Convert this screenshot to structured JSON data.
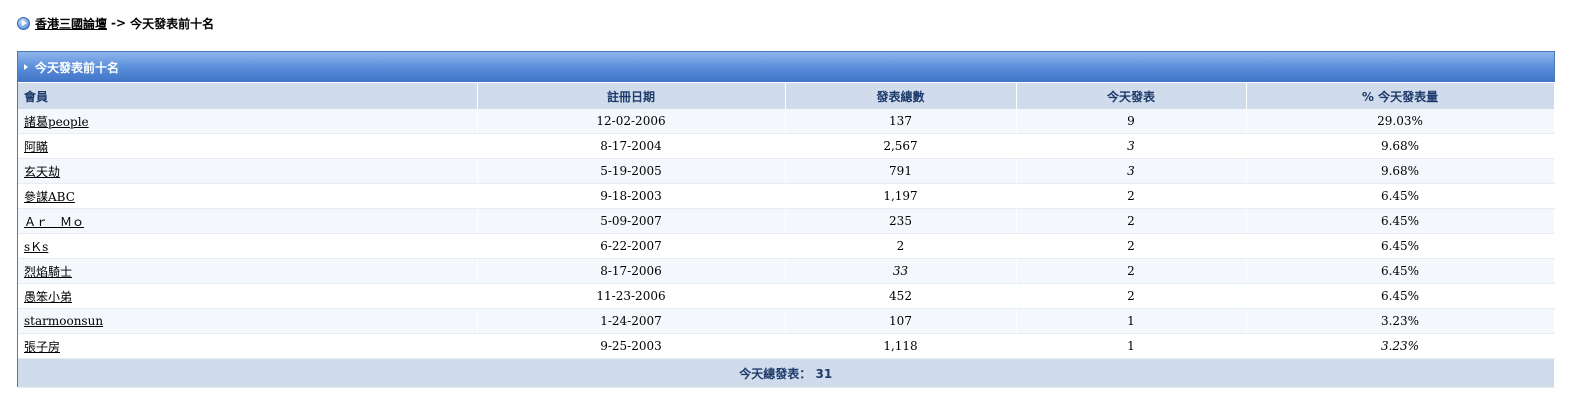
{
  "breadcrumb": {
    "forum_name": "香港三國論壇",
    "separator": "->",
    "current": "今天發表前十名"
  },
  "panel": {
    "title": "今天發表前十名"
  },
  "columns": [
    "會員",
    "註冊日期",
    "發表總數",
    "今天發表",
    "% 今天發表量"
  ],
  "rows": [
    {
      "member": "諸葛people",
      "reg_date": "12-02-2006",
      "total_posts": "137",
      "today_posts": "9",
      "percent": "29.03%"
    },
    {
      "member": "阿瞞",
      "reg_date": "8-17-2004",
      "total_posts": "2,567",
      "today_posts": "3",
      "percent": "9.68%"
    },
    {
      "member": "玄天劫",
      "reg_date": "5-19-2005",
      "total_posts": "791",
      "today_posts": "3",
      "percent": "9.68%"
    },
    {
      "member": "參謀ABC",
      "reg_date": "9-18-2003",
      "total_posts": "1,197",
      "today_posts": "2",
      "percent": "6.45%"
    },
    {
      "member": "Ａｒ　Ｍｏ",
      "reg_date": "5-09-2007",
      "total_posts": "235",
      "today_posts": "2",
      "percent": "6.45%"
    },
    {
      "member": "sＫs",
      "reg_date": "6-22-2007",
      "total_posts": "2",
      "today_posts": "2",
      "percent": "6.45%"
    },
    {
      "member": "烈焰騎士",
      "reg_date": "8-17-2006",
      "total_posts": "33",
      "today_posts": "2",
      "percent": "6.45%"
    },
    {
      "member": "愚笨小弟",
      "reg_date": "11-23-2006",
      "total_posts": "452",
      "today_posts": "2",
      "percent": "6.45%"
    },
    {
      "member": "starmoonsun",
      "reg_date": "1-24-2007",
      "total_posts": "107",
      "today_posts": "1",
      "percent": "3.23%"
    },
    {
      "member": "張子房",
      "reg_date": "9-25-2003",
      "total_posts": "1,118",
      "today_posts": "1",
      "percent": "3.23%"
    }
  ],
  "footer": {
    "label": "今天總發表：",
    "total": "31"
  }
}
